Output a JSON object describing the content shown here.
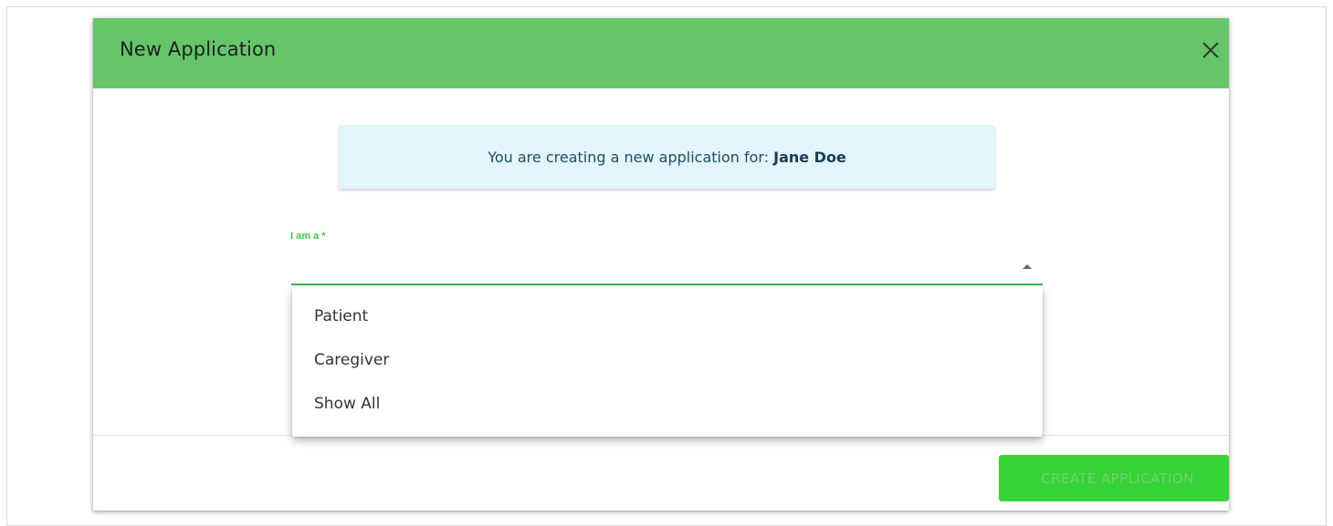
{
  "dialog": {
    "title": "New Application",
    "close_icon": "close-icon"
  },
  "notice": {
    "prefix": "You are creating a new application for:",
    "name": "Jane Doe"
  },
  "field": {
    "label": "I am a *",
    "selected_value": ""
  },
  "dropdown": {
    "options": [
      "Patient",
      "Caregiver",
      "Show All"
    ]
  },
  "footer": {
    "create_label": "CREATE APPLICATION"
  },
  "colors": {
    "header_bg": "#66c56a",
    "notice_bg": "#e3f4fb",
    "accent_green": "#3bb84a",
    "button_bg": "#35d335"
  }
}
